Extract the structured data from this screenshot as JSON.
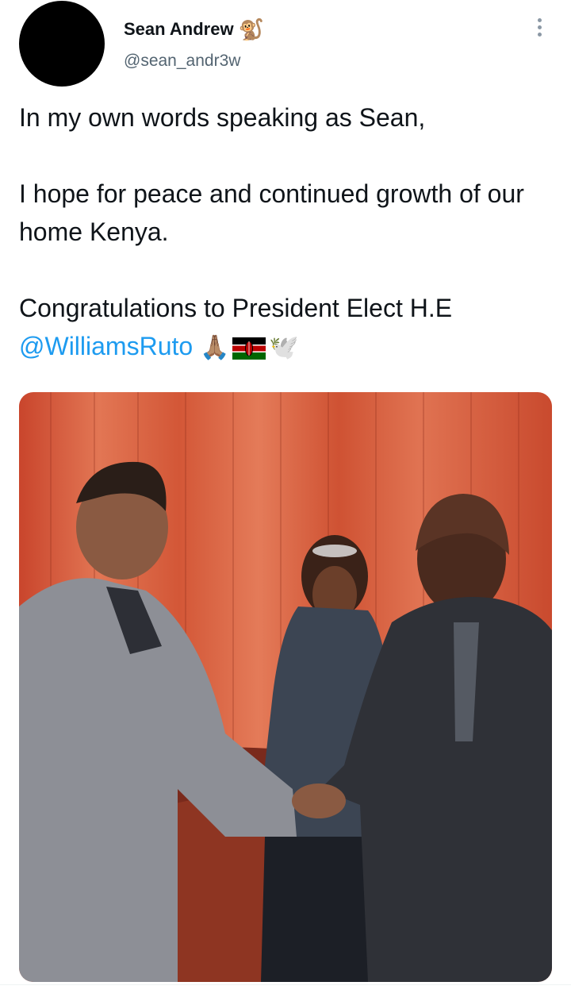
{
  "tweet": {
    "author": {
      "display_name": "Sean Andrew",
      "name_emoji": "🐒",
      "handle": "@sean_andr3w"
    },
    "paragraphs": [
      "In my own words speaking as Sean,",
      "I hope for peace and continued growth of our home Kenya."
    ],
    "last_line_text": "Congratulations to President Elect H.E",
    "mention": "@WilliamsRuto",
    "emojis": {
      "pray": "🙏🏽",
      "dove": "🕊️"
    }
  },
  "icons": {
    "more": "more-horizontal-icon",
    "flag": "kenya-flag-icon"
  },
  "colors": {
    "text": "#0f1419",
    "secondary": "#536471",
    "link": "#1d9bf0",
    "avatar": "#000000",
    "curtain": "#d9583a"
  }
}
